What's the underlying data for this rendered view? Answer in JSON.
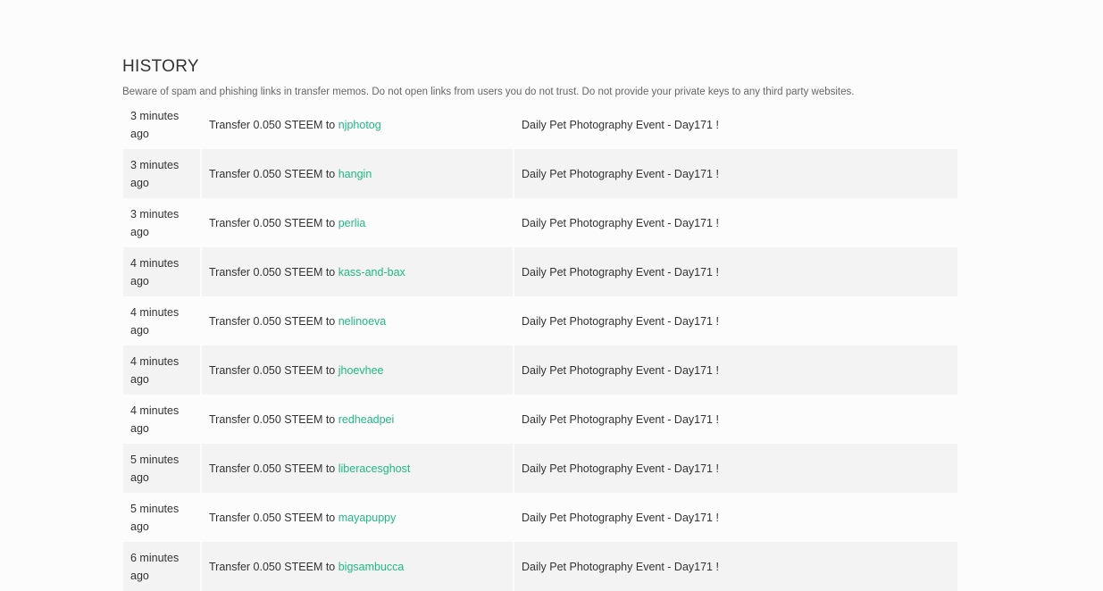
{
  "history": {
    "title": "HISTORY",
    "warning": "Beware of spam and phishing links in transfer memos. Do not open links from users you do not trust. Do not provide your private keys to any third party websites.",
    "rows": [
      {
        "time": "3 minutes ago",
        "op_prefix": "Transfer 0.050 STEEM to ",
        "recipient": "njphotog",
        "memo": "Daily Pet Photography Event - Day171 !"
      },
      {
        "time": "3 minutes ago",
        "op_prefix": "Transfer 0.050 STEEM to ",
        "recipient": "hangin",
        "memo": "Daily Pet Photography Event - Day171 !"
      },
      {
        "time": "3 minutes ago",
        "op_prefix": "Transfer 0.050 STEEM to ",
        "recipient": "perlia",
        "memo": "Daily Pet Photography Event - Day171 !"
      },
      {
        "time": "4 minutes ago",
        "op_prefix": "Transfer 0.050 STEEM to ",
        "recipient": "kass-and-bax",
        "memo": "Daily Pet Photography Event - Day171 !"
      },
      {
        "time": "4 minutes ago",
        "op_prefix": "Transfer 0.050 STEEM to ",
        "recipient": "nelinoeva",
        "memo": "Daily Pet Photography Event - Day171 !"
      },
      {
        "time": "4 minutes ago",
        "op_prefix": "Transfer 0.050 STEEM to ",
        "recipient": "jhoevhee",
        "memo": "Daily Pet Photography Event - Day171 !"
      },
      {
        "time": "4 minutes ago",
        "op_prefix": "Transfer 0.050 STEEM to ",
        "recipient": "redheadpei",
        "memo": "Daily Pet Photography Event - Day171 !"
      },
      {
        "time": "5 minutes ago",
        "op_prefix": "Transfer 0.050 STEEM to ",
        "recipient": "liberacesghost",
        "memo": "Daily Pet Photography Event - Day171 !"
      },
      {
        "time": "5 minutes ago",
        "op_prefix": "Transfer 0.050 STEEM to ",
        "recipient": "mayapuppy",
        "memo": "Daily Pet Photography Event - Day171 !"
      },
      {
        "time": "6 minutes ago",
        "op_prefix": "Transfer 0.050 STEEM to ",
        "recipient": "bigsambucca",
        "memo": "Daily Pet Photography Event - Day171 !"
      }
    ]
  },
  "colors": {
    "link": "#1fb984",
    "row_alt": "#f3f3f3",
    "background": "#fcfcfc"
  }
}
